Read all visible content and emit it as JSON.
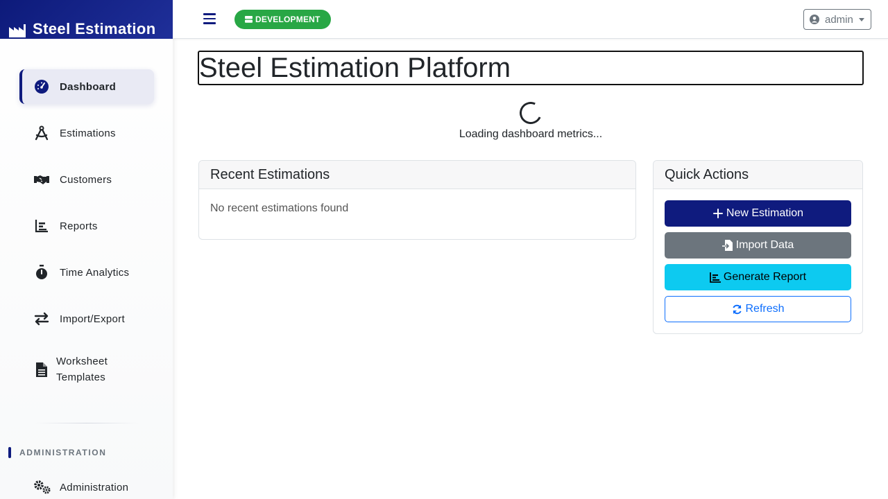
{
  "brand": {
    "title": "Steel Estimation",
    "icon": "factory-icon"
  },
  "sidebar": {
    "items": [
      {
        "label": "Dashboard",
        "icon": "gauge-icon",
        "active": true
      },
      {
        "label": "Estimations",
        "icon": "drafting-compass-icon"
      },
      {
        "label": "Customers",
        "icon": "handshake-icon"
      },
      {
        "label": "Reports",
        "icon": "bar-chart-icon"
      },
      {
        "label": "Time Analytics",
        "icon": "stopwatch-icon"
      },
      {
        "label": "Import/Export",
        "icon": "arrows-exchange-icon"
      },
      {
        "label": "Worksheet Templates",
        "icon": "file-text-icon"
      }
    ],
    "section_title": "ADMINISTRATION",
    "admin_item": {
      "label": "Administration",
      "icon": "gears-icon"
    }
  },
  "topbar": {
    "env_badge": "DEVELOPMENT",
    "user": "admin"
  },
  "main": {
    "title": "Steel Estimation Platform",
    "loading_text": "Loading dashboard metrics...",
    "recent": {
      "header": "Recent Estimations",
      "empty_text": "No recent estimations found"
    },
    "quick_actions": {
      "header": "Quick Actions",
      "new_estimation": "New Estimation",
      "import_data": "Import Data",
      "generate_report": "Generate Report",
      "refresh": "Refresh"
    }
  },
  "colors": {
    "primary": "#0f1b7e",
    "success": "#28a745",
    "secondary": "#6c757d",
    "info": "#0dcaf0",
    "link": "#0d6efd"
  }
}
